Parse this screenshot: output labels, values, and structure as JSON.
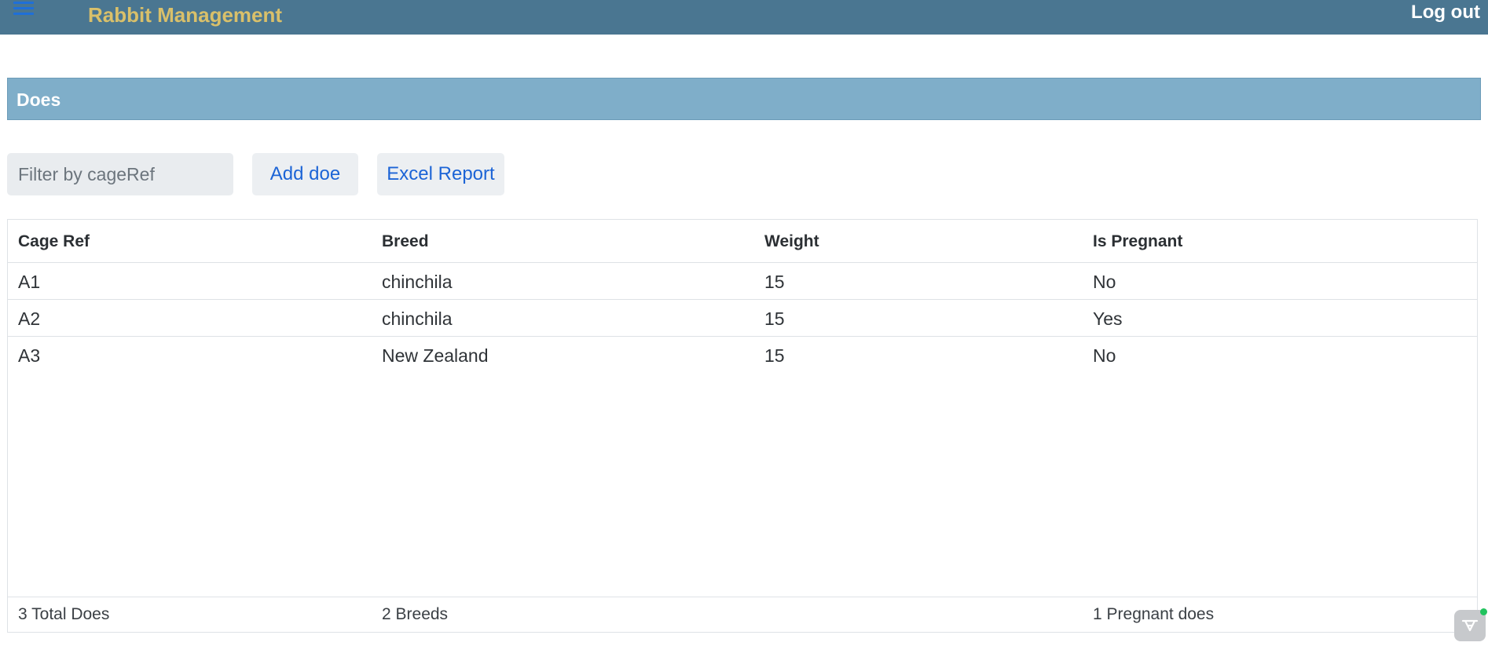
{
  "app": {
    "title": "Rabbit Management",
    "logout_label": "Log out",
    "menu_icon": "hamburger-menu-icon",
    "colors": {
      "topbar": "#4a7691",
      "title": "#d9c06a",
      "section_header": "#7faec9",
      "link": "#1c64d6"
    }
  },
  "section": {
    "title": "Does"
  },
  "toolbar": {
    "filter_placeholder": "Filter by cageRef",
    "filter_value": "",
    "add_label": "Add doe",
    "excel_label": "Excel Report"
  },
  "table": {
    "columns": [
      "Cage Ref",
      "Breed",
      "Weight",
      "Is Pregnant"
    ],
    "rows": [
      {
        "cage_ref": "A1",
        "breed": "chinchila",
        "weight": "15",
        "is_pregnant": "No"
      },
      {
        "cage_ref": "A2",
        "breed": "chinchila",
        "weight": "15",
        "is_pregnant": "Yes"
      },
      {
        "cage_ref": "A3",
        "breed": "New Zealand",
        "weight": "15",
        "is_pregnant": "No"
      }
    ],
    "footer": {
      "total": "3 Total Does",
      "breeds": "2 Breeds",
      "weight": "",
      "pregnant": "1 Pregnant does"
    }
  },
  "widget": {
    "icon": "chat-widget-icon",
    "status_color": "#22c35e"
  }
}
